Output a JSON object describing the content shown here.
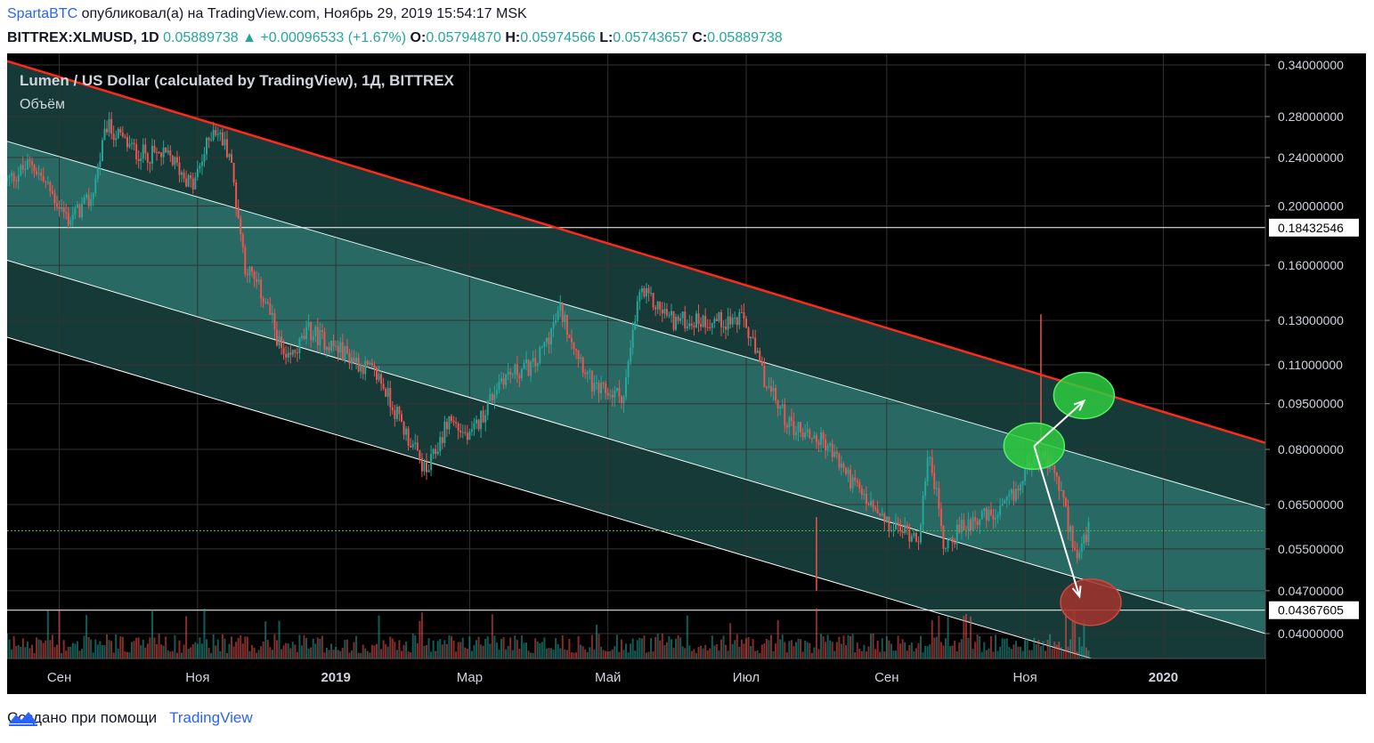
{
  "header": {
    "author": "SpartaBTC",
    "published_text": " опубликовал(а) на TradingView.com, Ноябрь 29, 2019 15:54:17 MSK",
    "symbol": "BITTREX:XLMUSD, 1D",
    "last": "0.05889738",
    "change_arrow": "▲",
    "change": "+0.00096533 (+1.67%)",
    "o_label": "O:",
    "o_value": "0.05794870",
    "h_label": "H:",
    "h_value": "0.05974566",
    "l_label": "L:",
    "l_value": "0.05743657",
    "c_label": "C:",
    "c_value": "0.05889738"
  },
  "legend": {
    "title": "Lumen / US Dollar (calculated by TradingView), 1Д, BITTREX",
    "volume": "Объём"
  },
  "footer": {
    "created_with": "Создано при помощи",
    "brand": "TradingView"
  },
  "colors": {
    "up": "#26a69a",
    "down": "#ef5350",
    "channel_line": "#ff2a1a",
    "channel_fill": "#4fd1c5",
    "ellipse_green": "#2ecc40",
    "ellipse_red": "#a3332c"
  },
  "chart_data": {
    "type": "candlestick",
    "symbol": "XLMUSD",
    "exchange": "BITTREX",
    "interval": "1D",
    "y_scale": "log",
    "y_ticks": [
      "0.34000000",
      "0.28000000",
      "0.24000000",
      "0.20000000",
      "0.16000000",
      "0.13000000",
      "0.11000000",
      "0.09500000",
      "0.08000000",
      "0.06500000",
      "0.05500000",
      "0.04700000",
      "0.04000000"
    ],
    "y_tick_values": [
      0.34,
      0.28,
      0.24,
      0.2,
      0.16,
      0.13,
      0.11,
      0.095,
      0.08,
      0.065,
      0.055,
      0.047,
      0.04
    ],
    "price_lines": [
      {
        "label": "0.18432546",
        "value": 0.18432546
      },
      {
        "label": "0.04367605",
        "value": 0.04367605
      }
    ],
    "last_price": 0.05889738,
    "x_ticks": [
      "Сен",
      "Ноя",
      "2019",
      "Мар",
      "Май",
      "Июл",
      "Сен",
      "Ноя",
      "2020"
    ],
    "x_tick_dates": [
      "2018-09-01",
      "2018-11-01",
      "2019-01-01",
      "2019-03-01",
      "2019-05-01",
      "2019-07-01",
      "2019-09-01",
      "2019-11-01",
      "2020-01-01"
    ],
    "x_range": [
      "2018-08-09",
      "2020-02-15"
    ],
    "price_path": [
      [
        "2018-08-09",
        0.22
      ],
      [
        "2018-08-20",
        0.235
      ],
      [
        "2018-09-05",
        0.19
      ],
      [
        "2018-09-15",
        0.205
      ],
      [
        "2018-09-22",
        0.27
      ],
      [
        "2018-10-05",
        0.245
      ],
      [
        "2018-10-20",
        0.24
      ],
      [
        "2018-10-30",
        0.215
      ],
      [
        "2018-11-08",
        0.27
      ],
      [
        "2018-11-15",
        0.245
      ],
      [
        "2018-11-22",
        0.16
      ],
      [
        "2018-12-01",
        0.14
      ],
      [
        "2018-12-10",
        0.11
      ],
      [
        "2018-12-20",
        0.125
      ],
      [
        "2019-01-05",
        0.115
      ],
      [
        "2019-01-20",
        0.105
      ],
      [
        "2019-02-01",
        0.085
      ],
      [
        "2019-02-10",
        0.073
      ],
      [
        "2019-02-20",
        0.09
      ],
      [
        "2019-03-01",
        0.083
      ],
      [
        "2019-03-15",
        0.105
      ],
      [
        "2019-03-30",
        0.11
      ],
      [
        "2019-04-10",
        0.135
      ],
      [
        "2019-04-25",
        0.1
      ],
      [
        "2019-05-08",
        0.098
      ],
      [
        "2019-05-15",
        0.145
      ],
      [
        "2019-05-30",
        0.13
      ],
      [
        "2019-06-15",
        0.13
      ],
      [
        "2019-06-30",
        0.13
      ],
      [
        "2019-07-10",
        0.102
      ],
      [
        "2019-07-20",
        0.088
      ],
      [
        "2019-08-05",
        0.082
      ],
      [
        "2019-08-20",
        0.068
      ],
      [
        "2019-09-01",
        0.06
      ],
      [
        "2019-09-15",
        0.058
      ],
      [
        "2019-09-20",
        0.08
      ],
      [
        "2019-09-26",
        0.056
      ],
      [
        "2019-10-10",
        0.062
      ],
      [
        "2019-10-20",
        0.062
      ],
      [
        "2019-10-30",
        0.07
      ],
      [
        "2019-11-05",
        0.08
      ],
      [
        "2019-11-15",
        0.072
      ],
      [
        "2019-11-24",
        0.053
      ],
      [
        "2019-11-29",
        0.0589
      ]
    ],
    "channel": {
      "top": [
        [
          "2018-08-09",
          0.345
        ],
        [
          "2020-02-15",
          0.082
        ]
      ],
      "upper_mid": [
        [
          "2018-08-09",
          0.255
        ],
        [
          "2020-02-15",
          0.064
        ]
      ],
      "lower_mid": [
        [
          "2018-08-09",
          0.163
        ],
        [
          "2020-02-15",
          0.04
        ]
      ],
      "bottom": [
        [
          "2018-08-09",
          0.122
        ],
        [
          "2020-02-15",
          0.03
        ]
      ]
    },
    "annotations": [
      {
        "type": "ellipse",
        "color": "green",
        "date": "2019-11-05",
        "price": 0.081
      },
      {
        "type": "ellipse",
        "color": "green",
        "date": "2019-11-27",
        "price": 0.098
      },
      {
        "type": "ellipse",
        "color": "red",
        "date": "2019-11-30",
        "price": 0.045
      },
      {
        "type": "arrow",
        "from": [
          "2019-11-05",
          0.081
        ],
        "to": [
          "2019-11-27",
          0.096
        ]
      },
      {
        "type": "arrow",
        "from": [
          "2019-11-05",
          0.081
        ],
        "to": [
          "2019-11-25",
          0.046
        ]
      }
    ]
  }
}
